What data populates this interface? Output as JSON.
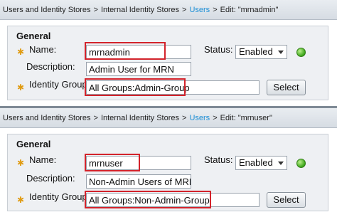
{
  "panels": [
    {
      "breadcrumb": {
        "item1": "Users and Identity Stores",
        "item2": "Internal Identity Stores",
        "item3": "Users",
        "item4": "Edit: \"mrnadmin\"",
        "sep": ">"
      },
      "section_title": "General",
      "name_label": "Name:",
      "name_value": "mrnadmin",
      "status_label": "Status:",
      "status_value": "Enabled",
      "description_label": "Description:",
      "description_value": "Admin User for MRN",
      "group_label": "Identity Group:",
      "group_value": "All Groups:Admin-Group",
      "select_label": "Select",
      "required_icon": "asterisk-icon",
      "status_icon": "green-status-dot"
    },
    {
      "breadcrumb": {
        "item1": "Users and Identity Stores",
        "item2": "Internal Identity Stores",
        "item3": "Users",
        "item4": "Edit: \"mrnuser\"",
        "sep": ">"
      },
      "section_title": "General",
      "name_label": "Name:",
      "name_value": "mrnuser",
      "status_label": "Status:",
      "status_value": "Enabled",
      "description_label": "Description:",
      "description_value": "Non-Admin Users of MRN",
      "group_label": "Identity Group:",
      "group_value": "All Groups:Non-Admin-Group",
      "select_label": "Select",
      "required_icon": "asterisk-icon",
      "status_icon": "green-status-dot"
    }
  ],
  "colors": {
    "highlight": "#d3232b",
    "active_crumb": "#1d8fd6",
    "required": "#e09b12",
    "status_ok": "#3ca51a"
  }
}
